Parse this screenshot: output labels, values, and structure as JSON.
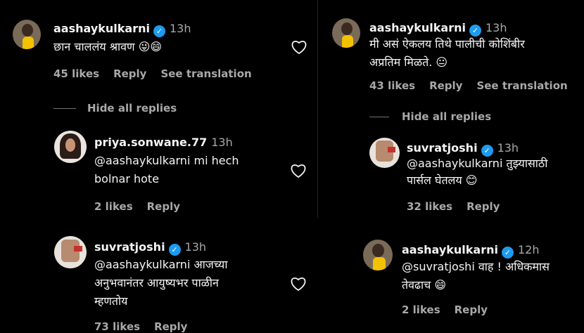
{
  "left": {
    "comment1": {
      "username": "aashaykulkarni",
      "time": "13h",
      "text": "छान चाललंय श्रावण 😜😄",
      "likes": "45 likes",
      "reply": "Reply",
      "translate": "See translation"
    },
    "hide_replies": "Hide all replies",
    "reply1": {
      "username": "priya.sonwane.77",
      "time": "13h",
      "text_line1": "@aashaykulkarni mi hech",
      "text_line2": "bolnar hote",
      "likes": "2 likes",
      "reply": "Reply"
    },
    "reply2": {
      "username": "suvratjoshi",
      "time": "13h",
      "text_line1": "@aashaykulkarni आजच्या",
      "text_line2": "अनुभवानंतर आयुष्यभर पाळीन",
      "text_line3": "म्हणतोय",
      "likes": "73 likes",
      "reply": "Reply"
    }
  },
  "right": {
    "comment1": {
      "username": "aashaykulkarni",
      "time": "13h",
      "text_line1": "मी असं ऐकलय तिथे पालीची कोशिंबीर",
      "text_line2": "अप्रतिम मिळते. 😐",
      "likes": "43 likes",
      "reply": "Reply",
      "translate": "See translation"
    },
    "hide_replies": "Hide all replies",
    "reply1": {
      "username": "suvratjoshi",
      "time": "13h",
      "text_line1": "@aashaykulkarni तुझ्यासाठी",
      "text_line2": "पार्सल घेतलय 😊",
      "likes": "32 likes",
      "reply": "Reply"
    },
    "reply2": {
      "username": "aashaykulkarni",
      "time": "12h",
      "text_line1": "@suvratjoshi वाह ! अधिकमास",
      "text_line2": "तेवढाच 😄",
      "likes": "2 likes",
      "reply": "Reply"
    }
  },
  "icons": {
    "verified": "✓"
  },
  "colors": {
    "verified": "#1d9bf0",
    "muted": "#a8a8a8",
    "background": "#000000"
  }
}
